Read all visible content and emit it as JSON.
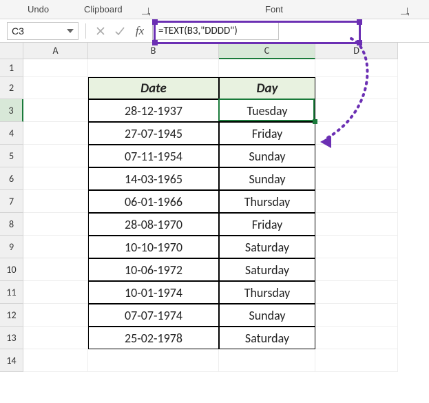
{
  "ribbon": {
    "undo": "Undo",
    "clipboard": "Clipboard",
    "font": "Font"
  },
  "formula_bar": {
    "cell_ref": "C3",
    "fx_label": "fx",
    "formula": "=TEXT(B3,\"DDDD\")"
  },
  "columns": [
    "A",
    "B",
    "C",
    "D"
  ],
  "row_numbers": [
    "1",
    "2",
    "3",
    "4",
    "5",
    "6",
    "7",
    "8",
    "9",
    "10",
    "11",
    "12",
    "13",
    "14"
  ],
  "table": {
    "headers": {
      "date": "Date",
      "day": "Day"
    },
    "rows": [
      {
        "date": "28-12-1937",
        "day": "Tuesday"
      },
      {
        "date": "27-07-1945",
        "day": "Friday"
      },
      {
        "date": "07-11-1954",
        "day": "Sunday"
      },
      {
        "date": "14-03-1965",
        "day": "Sunday"
      },
      {
        "date": "06-01-1966",
        "day": "Thursday"
      },
      {
        "date": "28-08-1970",
        "day": "Friday"
      },
      {
        "date": "10-10-1970",
        "day": "Saturday"
      },
      {
        "date": "10-06-1972",
        "day": "Saturday"
      },
      {
        "date": "10-01-1974",
        "day": "Thursday"
      },
      {
        "date": "07-07-1974",
        "day": "Sunday"
      },
      {
        "date": "25-02-1978",
        "day": "Saturday"
      }
    ]
  },
  "selection": {
    "cell": "C3",
    "row": 3,
    "col": "C"
  },
  "annotation": {
    "highlight_target": "formula-bar-fx-and-input",
    "arrow_from": "formula-input",
    "arrow_to": "C3",
    "color": "#6b2fb3"
  },
  "chart_data": {
    "type": "table",
    "title": "",
    "columns": [
      "Date",
      "Day"
    ],
    "rows": [
      [
        "28-12-1937",
        "Tuesday"
      ],
      [
        "27-07-1945",
        "Friday"
      ],
      [
        "07-11-1954",
        "Sunday"
      ],
      [
        "14-03-1965",
        "Sunday"
      ],
      [
        "06-01-1966",
        "Thursday"
      ],
      [
        "28-08-1970",
        "Friday"
      ],
      [
        "10-10-1970",
        "Saturday"
      ],
      [
        "10-06-1972",
        "Saturday"
      ],
      [
        "10-01-1974",
        "Thursday"
      ],
      [
        "07-07-1974",
        "Sunday"
      ],
      [
        "25-02-1978",
        "Saturday"
      ]
    ]
  }
}
